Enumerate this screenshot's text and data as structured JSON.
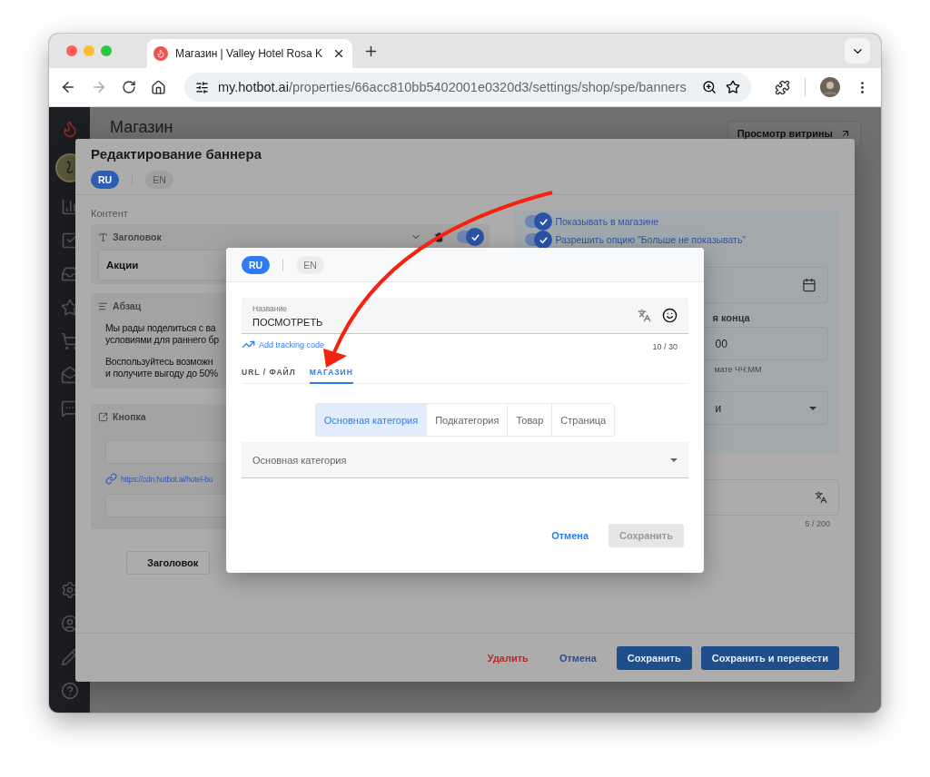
{
  "browser": {
    "tab_title": "Магазин | Valley Hotel Rosa K",
    "url_host": "my.hotbot.ai",
    "url_path": "/properties/66acc810bb5402001e0320d3/settings/shop/spe/banners",
    "forward_disabled": true
  },
  "page": {
    "title": "Магазин",
    "preview_button": "Просмотр витрины"
  },
  "dialog": {
    "title": "Редактирование баннера",
    "languages": [
      {
        "label": "RU",
        "selected": true
      },
      {
        "label": "EN",
        "selected": false
      }
    ],
    "content_label": "Контент",
    "blocks": [
      {
        "kind": "heading",
        "title": "Заголовок",
        "value": "Акции",
        "on": true
      },
      {
        "kind": "paragraph",
        "title": "Абзац",
        "paragraphs": [
          [
            "Мы рады поделиться с ва",
            "условиями для раннего бр"
          ],
          [
            "Воспользуйтесь возможн",
            "и получите выгоду до 50%"
          ]
        ]
      },
      {
        "kind": "button",
        "title": "Кнопка",
        "link": "https://cdn.hotbot.ai/hotel-bo"
      }
    ],
    "add_buttons": [
      "Заголовок"
    ],
    "toggles": [
      {
        "label": "Показывать в магазине",
        "on": true
      },
      {
        "label": "Разрешить опцию \"Больше не показывать\"",
        "on": true
      }
    ],
    "end_label": "я конца",
    "end_time_value": "00",
    "end_time_hint": "мате ЧЧ:ММ",
    "select_value": "и",
    "text_counter": "5 / 200",
    "actions": [
      {
        "label": "Удалить",
        "kind": "danger"
      },
      {
        "label": "Отмена",
        "kind": "text"
      },
      {
        "label": "Сохранить",
        "kind": "primary"
      },
      {
        "label": "Сохранить и перевести",
        "kind": "primary"
      }
    ]
  },
  "link_modal": {
    "languages": [
      {
        "label": "RU",
        "selected": true
      },
      {
        "label": "EN",
        "selected": false
      }
    ],
    "name_field": {
      "label": "Название",
      "value": "ПОСМОТРЕТЬ",
      "counter": "10 / 30"
    },
    "tracking_link": "Add tracking code",
    "tabs": [
      {
        "label": "URL / ФАЙЛ",
        "selected": false
      },
      {
        "label": "МАГАЗИН",
        "selected": true
      }
    ],
    "segments": [
      {
        "label": "Основная категория",
        "selected": true
      },
      {
        "label": "Подкатегория",
        "selected": false
      },
      {
        "label": "Товар",
        "selected": false
      },
      {
        "label": "Страница",
        "selected": false
      }
    ],
    "select": {
      "placeholder": "Основная категория"
    },
    "actions": [
      {
        "label": "Отмена",
        "kind": "text",
        "disabled": false
      },
      {
        "label": "Сохранить",
        "kind": "primary",
        "disabled": true
      }
    ]
  }
}
